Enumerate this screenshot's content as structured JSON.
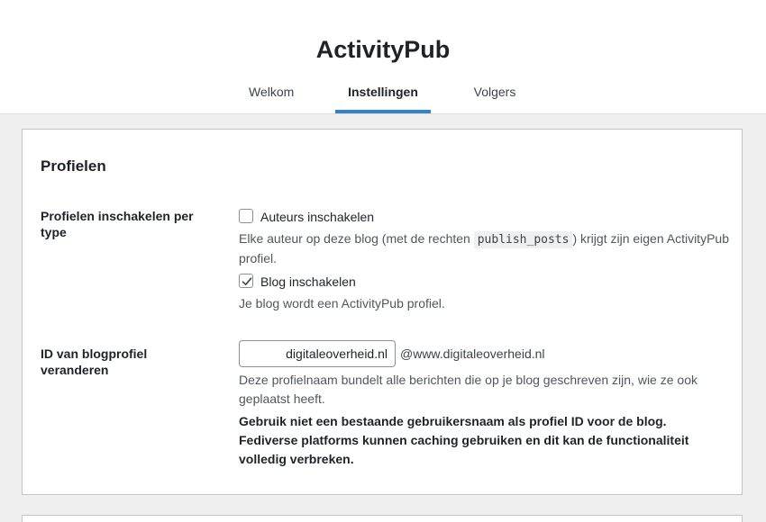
{
  "header": {
    "title": "ActivityPub",
    "tabs": [
      {
        "label": "Welkom",
        "active": false
      },
      {
        "label": "Instellingen",
        "active": true
      },
      {
        "label": "Volgers",
        "active": false
      }
    ],
    "accent_color": "#3582c4"
  },
  "profiles": {
    "section_title": "Profielen",
    "enable_label": "Profielen inschakelen per type",
    "authors": {
      "label": "Auteurs inschakelen",
      "checked": false,
      "desc_before": "Elke auteur op deze blog (met de rechten ",
      "desc_code": "publish_posts",
      "desc_after": ") krijgt zijn eigen ActivityPub profiel."
    },
    "blog": {
      "label": "Blog inschakelen",
      "checked": true,
      "desc": "Je blog wordt een ActivityPub profiel."
    },
    "blog_id": {
      "label": "ID van blogprofiel veranderen",
      "value": "digitaleoverheid.nl",
      "suffix": "@www.digitaleoverheid.nl",
      "desc": "Deze profielnaam bundelt alle berichten die op je blog geschreven zijn, wie ze ook geplaatst heeft.",
      "warning": "Gebruik niet een bestaande gebruikersnaam als profiel ID voor de blog. Fediverse platforms kunnen caching gebruiken en dit kan de functionaliteit volledig verbreken."
    }
  }
}
